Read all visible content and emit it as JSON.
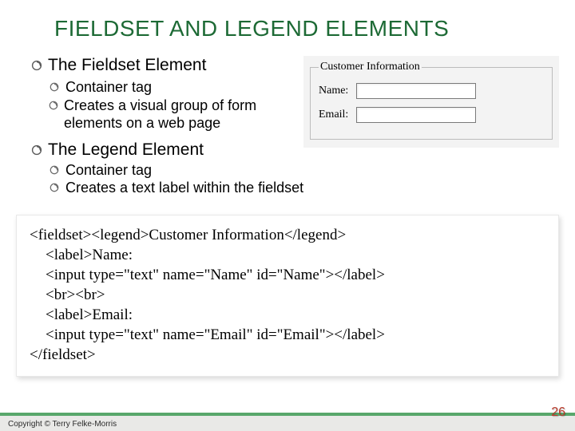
{
  "title": "FIELDSET AND LEGEND ELEMENTS",
  "sections": [
    {
      "heading": "The Fieldset Element",
      "items": [
        "Container tag",
        "Creates a visual group of form elements on a web page"
      ]
    },
    {
      "heading": "The Legend Element",
      "items": [
        "Container tag",
        "Creates a text label within the fieldset"
      ]
    }
  ],
  "demo": {
    "legend": "Customer Information",
    "name_label": "Name:",
    "email_label": "Email:",
    "name_value": "",
    "email_value": ""
  },
  "code": {
    "l1": "<fieldset><legend>Customer Information</legend>",
    "l2": "<label>Name:",
    "l3": "<input type=\"text\" name=\"Name\" id=\"Name\"></label>",
    "l4": "<br><br>",
    "l5": "<label>Email:",
    "l6": "<input type=\"text\" name=\"Email\" id=\"Email\"></label>",
    "l7": "</fieldset>"
  },
  "footer": {
    "copyright": "Copyright © Terry Felke-Morris",
    "page": "26"
  }
}
